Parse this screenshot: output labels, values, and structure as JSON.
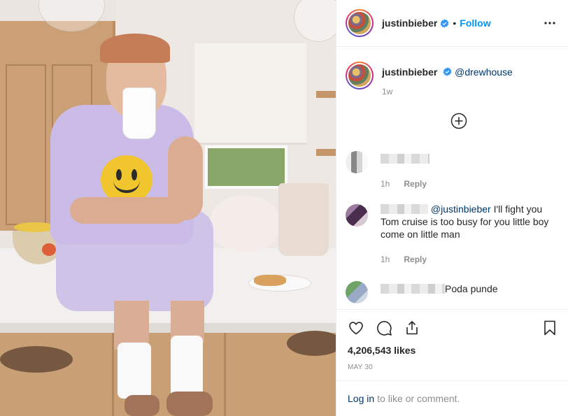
{
  "header": {
    "username": "justinbieber",
    "separator": "•",
    "follow_label": "Follow"
  },
  "caption": {
    "username": "justinbieber",
    "mention": "@drewhouse",
    "time": "1w"
  },
  "comments": [
    {
      "text": "",
      "time": "1h",
      "reply_label": "Reply"
    },
    {
      "mention": "@justinbieber",
      "text": " I'll fight you",
      "line2": "Tom cruise is too busy for you little boy",
      "line3": "come on little man",
      "time": "1h",
      "reply_label": "Reply"
    },
    {
      "text": "Poda punde"
    }
  ],
  "engagement": {
    "likes": "4,206,543 likes",
    "date": "MAY 30"
  },
  "login": {
    "link": "Log in",
    "text": "to like or comment."
  },
  "colors": {
    "link_blue": "#0095f6",
    "mention_blue": "#00376b",
    "muted_gray": "#8e8e8e",
    "verified_blue": "#3897f0"
  },
  "icons": [
    "verified-badge-icon",
    "more-options-icon",
    "plus-circle-icon",
    "heart-icon",
    "comment-icon",
    "share-icon",
    "bookmark-icon"
  ]
}
